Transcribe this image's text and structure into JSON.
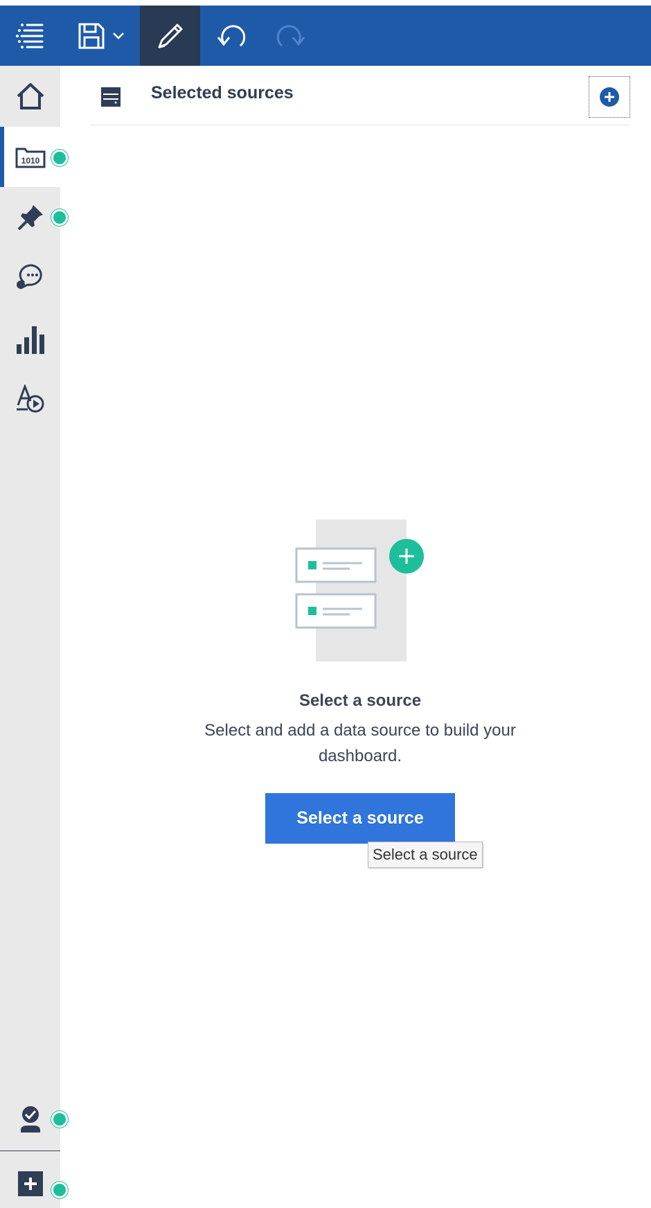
{
  "toolbar": {
    "items": [
      {
        "name": "menu-icon",
        "label": "Menu"
      },
      {
        "name": "save-icon",
        "label": "Save"
      },
      {
        "name": "edit-pencil-icon",
        "label": "Edit",
        "active": true
      },
      {
        "name": "undo-icon",
        "label": "Undo"
      },
      {
        "name": "redo-icon",
        "label": "Redo",
        "disabled": true
      }
    ]
  },
  "rail": {
    "items": [
      {
        "name": "home-icon"
      },
      {
        "name": "data-sources-icon",
        "selected": true,
        "status_dot": true
      },
      {
        "name": "pin-icon",
        "status_dot": true
      },
      {
        "name": "conversation-icon"
      },
      {
        "name": "visualizations-icon"
      },
      {
        "name": "text-media-icon"
      },
      {
        "name": "user-check-icon",
        "status_dot": true
      },
      {
        "name": "add-icon",
        "status_dot": true
      }
    ]
  },
  "header": {
    "title": "Selected sources",
    "icon": "server-icon",
    "add_icon": "plus-circle-icon"
  },
  "empty_state": {
    "title": "Select a source",
    "description": "Select and add a data source to build your dashboard.",
    "button_label": "Select a source",
    "tooltip": "Select a source"
  },
  "colors": {
    "toolbar": "#1f5aa8",
    "toolbar_active": "#293a54",
    "accent": "#1dbf9b",
    "button": "#2f75dc",
    "rail": "#e9e9e9"
  }
}
